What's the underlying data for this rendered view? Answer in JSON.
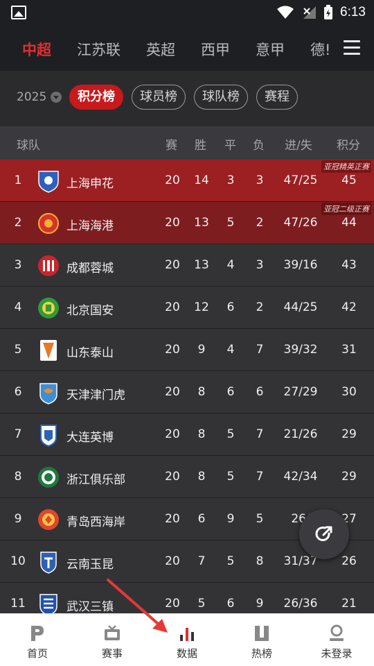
{
  "status_bar": {
    "time": "6:13"
  },
  "league_tabs": [
    "中超",
    "江苏联",
    "英超",
    "西甲",
    "意甲",
    "德!"
  ],
  "sub_tabs": {
    "year": "2025",
    "items": [
      "积分榜",
      "球员榜",
      "球队榜",
      "赛程"
    ]
  },
  "table": {
    "headers": {
      "team": "球队",
      "played": "赛",
      "won": "胜",
      "drawn": "平",
      "lost": "负",
      "goals": "进/失",
      "points": "积分"
    },
    "rows": [
      {
        "rank": "1",
        "name": "上海申花",
        "played": "20",
        "won": "14",
        "drawn": "3",
        "lost": "3",
        "goals": "47/25",
        "points": "45",
        "tag": "亚冠精英正赛",
        "logo_color": "#2d5fbf"
      },
      {
        "rank": "2",
        "name": "上海海港",
        "played": "20",
        "won": "13",
        "drawn": "5",
        "lost": "2",
        "goals": "47/26",
        "points": "44",
        "tag": "亚冠二级正赛",
        "logo_color": "#d8322a"
      },
      {
        "rank": "3",
        "name": "成都蓉城",
        "played": "20",
        "won": "13",
        "drawn": "4",
        "lost": "3",
        "goals": "39/16",
        "points": "43",
        "tag": "",
        "logo_color": "#c9252c"
      },
      {
        "rank": "4",
        "name": "北京国安",
        "played": "20",
        "won": "12",
        "drawn": "6",
        "lost": "2",
        "goals": "44/25",
        "points": "42",
        "tag": "",
        "logo_color": "#2f9a3c"
      },
      {
        "rank": "5",
        "name": "山东泰山",
        "played": "20",
        "won": "9",
        "drawn": "4",
        "lost": "7",
        "goals": "39/32",
        "points": "31",
        "tag": "",
        "logo_color": "#e8782a"
      },
      {
        "rank": "6",
        "name": "天津津门虎",
        "played": "20",
        "won": "8",
        "drawn": "6",
        "lost": "6",
        "goals": "27/29",
        "points": "30",
        "tag": "",
        "logo_color": "#3b8fd6"
      },
      {
        "rank": "7",
        "name": "大连英博",
        "played": "20",
        "won": "8",
        "drawn": "5",
        "lost": "7",
        "goals": "21/26",
        "points": "29",
        "tag": "",
        "logo_color": "#2a64b5"
      },
      {
        "rank": "8",
        "name": "浙江俱乐部",
        "played": "20",
        "won": "8",
        "drawn": "5",
        "lost": "7",
        "goals": "42/34",
        "points": "29",
        "tag": "",
        "logo_color": "#1f7a3d"
      },
      {
        "rank": "9",
        "name": "青岛西海岸",
        "played": "20",
        "won": "6",
        "drawn": "9",
        "lost": "5",
        "goals": "26/",
        "points": "27",
        "tag": "",
        "logo_color": "#e0462c"
      },
      {
        "rank": "10",
        "name": "云南玉昆",
        "played": "20",
        "won": "7",
        "drawn": "5",
        "lost": "8",
        "goals": "31/37",
        "points": "26",
        "tag": "",
        "logo_color": "#2f5fb0"
      },
      {
        "rank": "11",
        "name": "武汉三镇",
        "played": "20",
        "won": "5",
        "drawn": "6",
        "lost": "9",
        "goals": "26/36",
        "points": "21",
        "tag": "",
        "logo_color": "#2350a8"
      }
    ]
  },
  "bottom_nav": [
    "首页",
    "赛事",
    "数据",
    "热榜",
    "未登录"
  ],
  "colors": {
    "accent": "#c8191c",
    "active_tab": "#e0302f",
    "row_qualify_1": "#9c1f22",
    "row_qualify_2": "#7e1d1f"
  }
}
